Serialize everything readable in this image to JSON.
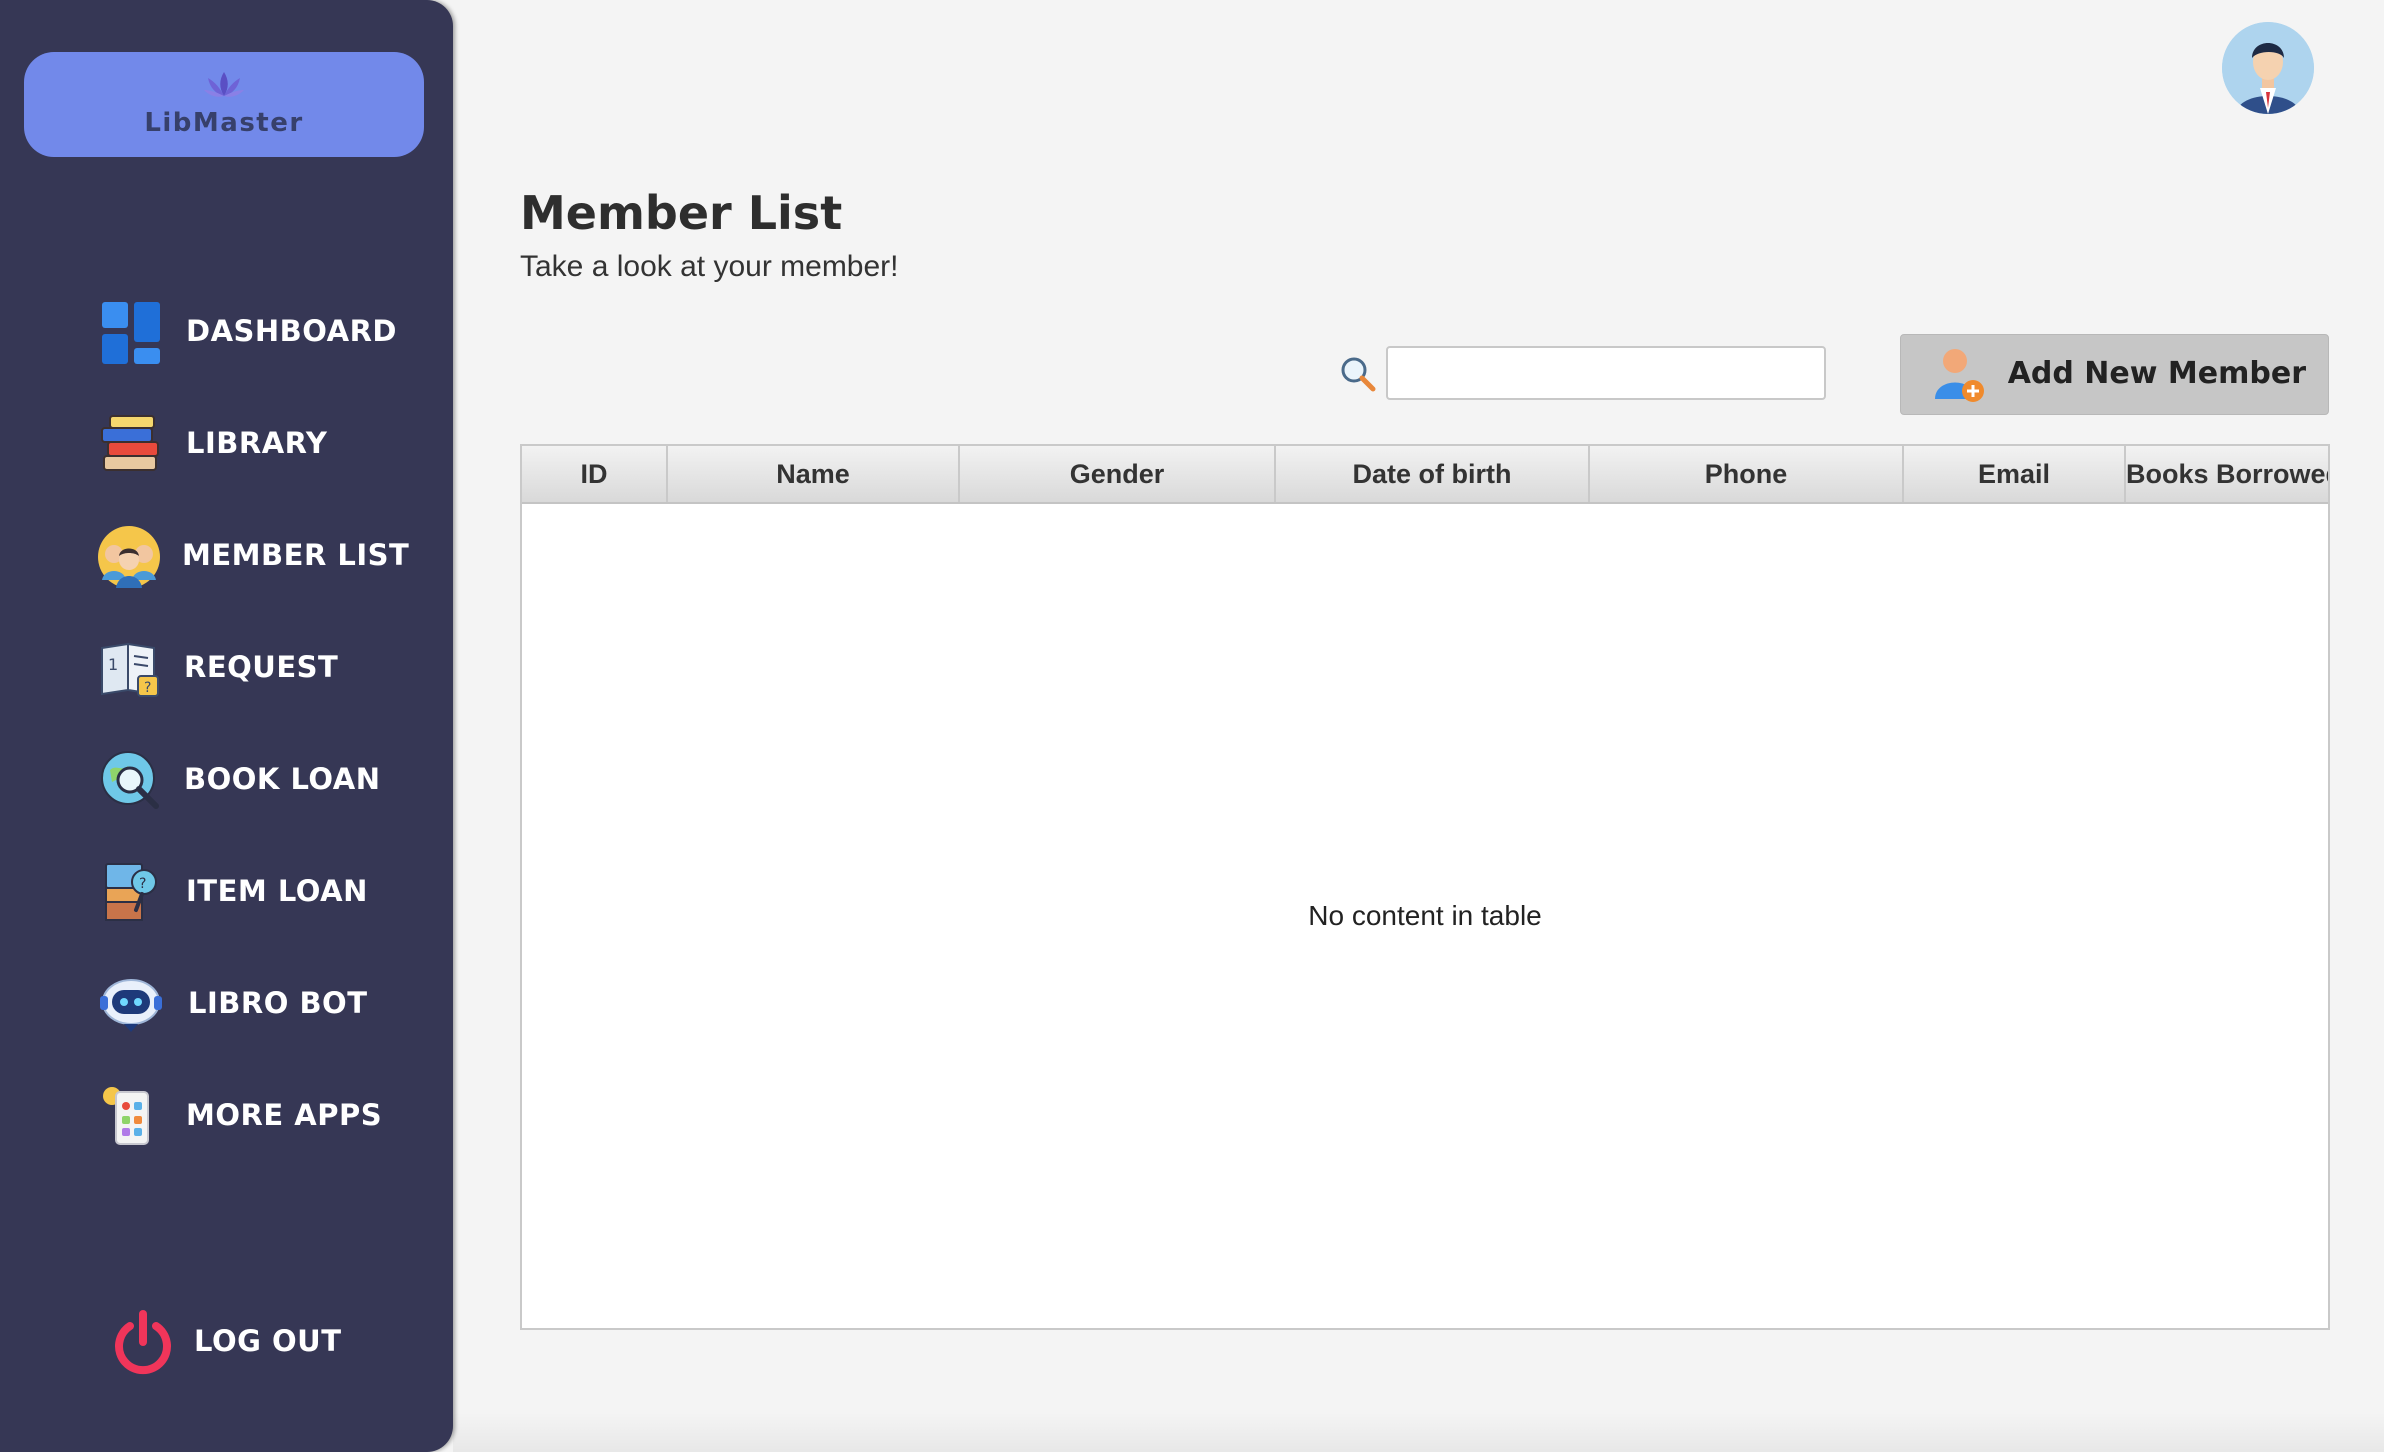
{
  "app": {
    "name": "LibMaster"
  },
  "sidebar": {
    "items": [
      {
        "label": "DASHBOARD",
        "icon": "dashboard-icon"
      },
      {
        "label": "LIBRARY",
        "icon": "books-icon"
      },
      {
        "label": "MEMBER LIST",
        "icon": "members-icon"
      },
      {
        "label": "REQUEST",
        "icon": "request-icon"
      },
      {
        "label": "BOOK LOAN",
        "icon": "book-loan-icon"
      },
      {
        "label": "ITEM LOAN",
        "icon": "item-loan-icon"
      },
      {
        "label": "LIBRO BOT",
        "icon": "robot-icon"
      },
      {
        "label": "MORE APPS",
        "icon": "apps-icon"
      }
    ],
    "logout": {
      "label": "LOG OUT",
      "icon": "power-icon"
    }
  },
  "header": {
    "avatar_icon": "user-avatar-icon"
  },
  "main": {
    "title": "Member List",
    "subtitle": "Take a look at your member!",
    "search": {
      "placeholder": "",
      "value": ""
    },
    "add_button": {
      "label": "Add New Member",
      "icon": "add-user-icon"
    },
    "table": {
      "columns": [
        "ID",
        "Name",
        "Gender",
        "Date of birth",
        "Phone",
        "Email",
        "Books Borrowed"
      ],
      "rows": [],
      "empty_message": "No content in table"
    }
  },
  "colors": {
    "sidebar_bg": "#363755",
    "logo_bg": "#7289ea",
    "page_bg": "#f4f4f4",
    "button_bg": "#c6c6c6"
  }
}
